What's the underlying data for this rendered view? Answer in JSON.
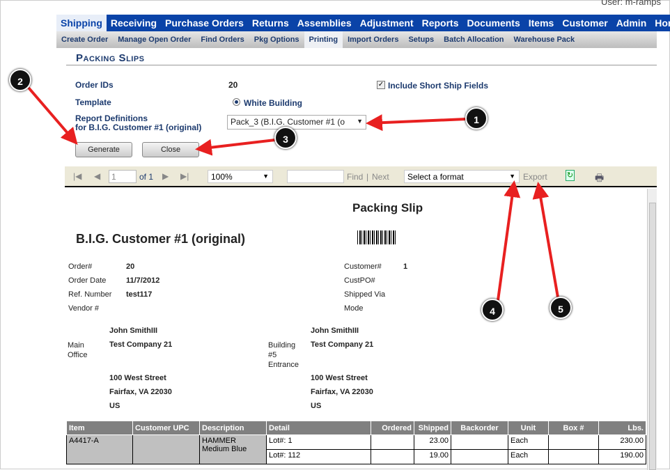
{
  "header": {
    "user": "User: m-ramps"
  },
  "nav": [
    "Shipping",
    "Receiving",
    "Purchase Orders",
    "Returns",
    "Assemblies",
    "Adjustment",
    "Reports",
    "Documents",
    "Items",
    "Customer",
    "Admin",
    "Home"
  ],
  "subnav": [
    "Create Order",
    "Manage Open Order",
    "Find Orders",
    "Pkg Options",
    "Printing",
    "Import Orders",
    "Setups",
    "Batch Allocation",
    "Warehouse Pack"
  ],
  "page_title": "Packing Slips",
  "form": {
    "order_ids_label": "Order IDs",
    "order_ids": "20",
    "template_label": "Template",
    "template_option": "White Building",
    "report_def_label1": "Report Definitions",
    "report_def_label2": "for B.I.G. Customer #1 (original)",
    "report_def_value": "Pack_3 (B.I.G. Customer #1 (o",
    "short_ship_label": "Include Short Ship Fields",
    "short_ship_checked": true,
    "generate": "Generate",
    "close": "Close"
  },
  "toolbar": {
    "page": "1",
    "of": "of 1",
    "zoom": "100%",
    "find": "Find",
    "sep": "|",
    "next": "Next",
    "format": "Select a format",
    "export": "Export"
  },
  "report": {
    "title": "Packing Slip",
    "customer": "B.I.G. Customer #1 (original)",
    "fields_left": [
      [
        "Order#",
        "20"
      ],
      [
        "Order Date",
        "11/7/2012"
      ],
      [
        "Ref. Number",
        "test117"
      ],
      [
        "Vendor #",
        ""
      ]
    ],
    "fields_right": [
      [
        "Customer#",
        "1"
      ],
      [
        "CustPO#",
        ""
      ],
      [
        "Shipped Via",
        ""
      ],
      [
        "Mode",
        ""
      ]
    ],
    "from": {
      "label": "Main Office",
      "name": "John SmithIII",
      "company": "Test Company 21",
      "street": "100 West Street",
      "city": "Fairfax, VA 22030",
      "country": "US"
    },
    "to": {
      "label": "Building #5 Entrance",
      "name": "John SmithIII",
      "company": "Test Company 21",
      "street": "100 West Street",
      "city": "Fairfax, VA 22030",
      "country": "US"
    },
    "columns": [
      "Item",
      "Customer UPC",
      "Description",
      "Detail",
      "Ordered",
      "Shipped",
      "Backorder",
      "Unit",
      "Box #",
      "Lbs."
    ],
    "item": "A4417-A",
    "upc": "",
    "description": "HAMMER Medium Blue",
    "lines": [
      {
        "detail": "Lot#: 1",
        "ordered": "",
        "shipped": "23.00",
        "backorder": "",
        "unit": "Each",
        "box": "",
        "lbs": "230.00"
      },
      {
        "detail": "Lot#: 112",
        "ordered": "",
        "shipped": "19.00",
        "backorder": "",
        "unit": "Each",
        "box": "",
        "lbs": "190.00"
      }
    ]
  },
  "callouts": [
    "1",
    "2",
    "3",
    "4",
    "5"
  ],
  "colors": {
    "nav": "#0a43a8",
    "callout_arrow": "#e82020"
  }
}
